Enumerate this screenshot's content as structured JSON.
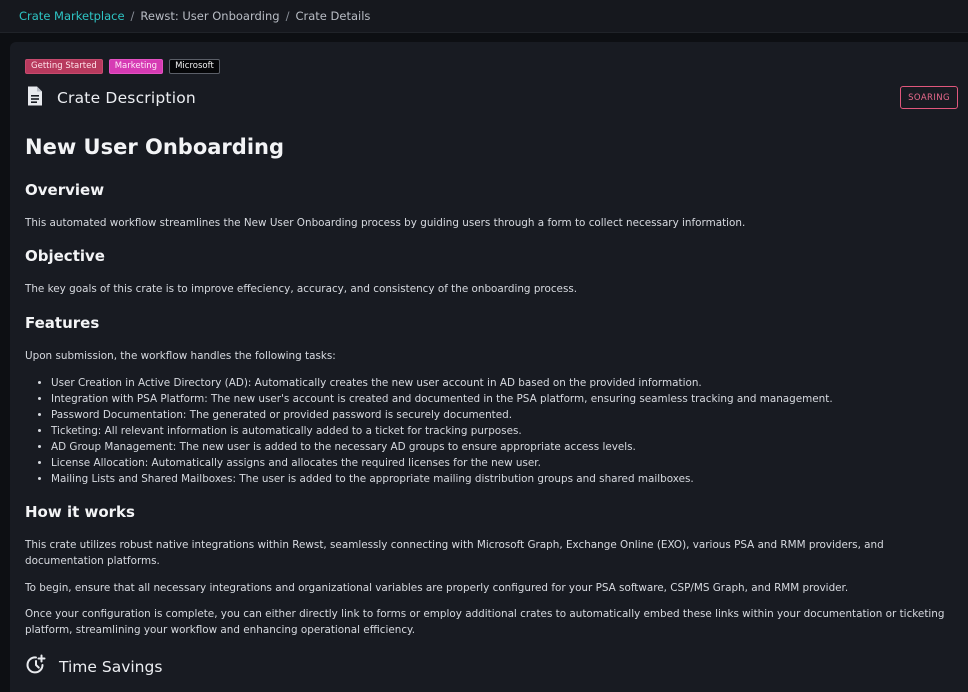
{
  "breadcrumb": {
    "items": [
      "Crate Marketplace",
      "Rewst: User Onboarding",
      "Crate Details"
    ],
    "separator": "/"
  },
  "tags": [
    "Getting Started",
    "Marketing",
    "Microsoft"
  ],
  "section_title": "Crate Description",
  "badge": "SOARING",
  "doc": {
    "title": "New User Onboarding",
    "overview_heading": "Overview",
    "overview_text": "This automated workflow streamlines the New User Onboarding process by guiding users through a form to collect necessary information.",
    "objective_heading": "Objective",
    "objective_text": "The key goals of this crate is to improve effeciency, accuracy, and consistency of the onboarding process.",
    "features_heading": "Features",
    "features_intro": "Upon submission, the workflow handles the following tasks:",
    "features": [
      "User Creation in Active Directory (AD): Automatically creates the new user account in AD based on the provided information.",
      "Integration with PSA Platform: The new user's account is created and documented in the PSA platform, ensuring seamless tracking and management.",
      "Password Documentation: The generated or provided password is securely documented.",
      "Ticketing: All relevant information is automatically added to a ticket for tracking purposes.",
      "AD Group Management: The new user is added to the necessary AD groups to ensure appropriate access levels.",
      "License Allocation: Automatically assigns and allocates the required licenses for the new user.",
      "Mailing Lists and Shared Mailboxes: The user is added to the appropriate mailing distribution groups and shared mailboxes."
    ],
    "how_heading": "How it works",
    "how_p1": "This crate utilizes robust native integrations within Rewst, seamlessly connecting with Microsoft Graph, Exchange Online (EXO), various PSA and RMM providers, and documentation platforms.",
    "how_p2": "To begin, ensure that all necessary integrations and organizational variables are properly configured for your PSA software, CSP/MS Graph, and RMM provider.",
    "how_p3": "Once your configuration is complete, you can either directly link to forms or employ additional crates to automatically embed these links within your documentation or ticketing platform, streamlining your workflow and enhancing operational efficiency."
  },
  "time_savings_title": "Time Savings",
  "icons": {
    "section": "document-icon",
    "time": "clock-plus-icon"
  },
  "colors": {
    "accent_teal": "#2ec4c4",
    "tag_getting_started": "#b83a5e",
    "tag_marketing": "#d63bb4",
    "tag_microsoft": "#050608",
    "badge": "#e0577c"
  }
}
